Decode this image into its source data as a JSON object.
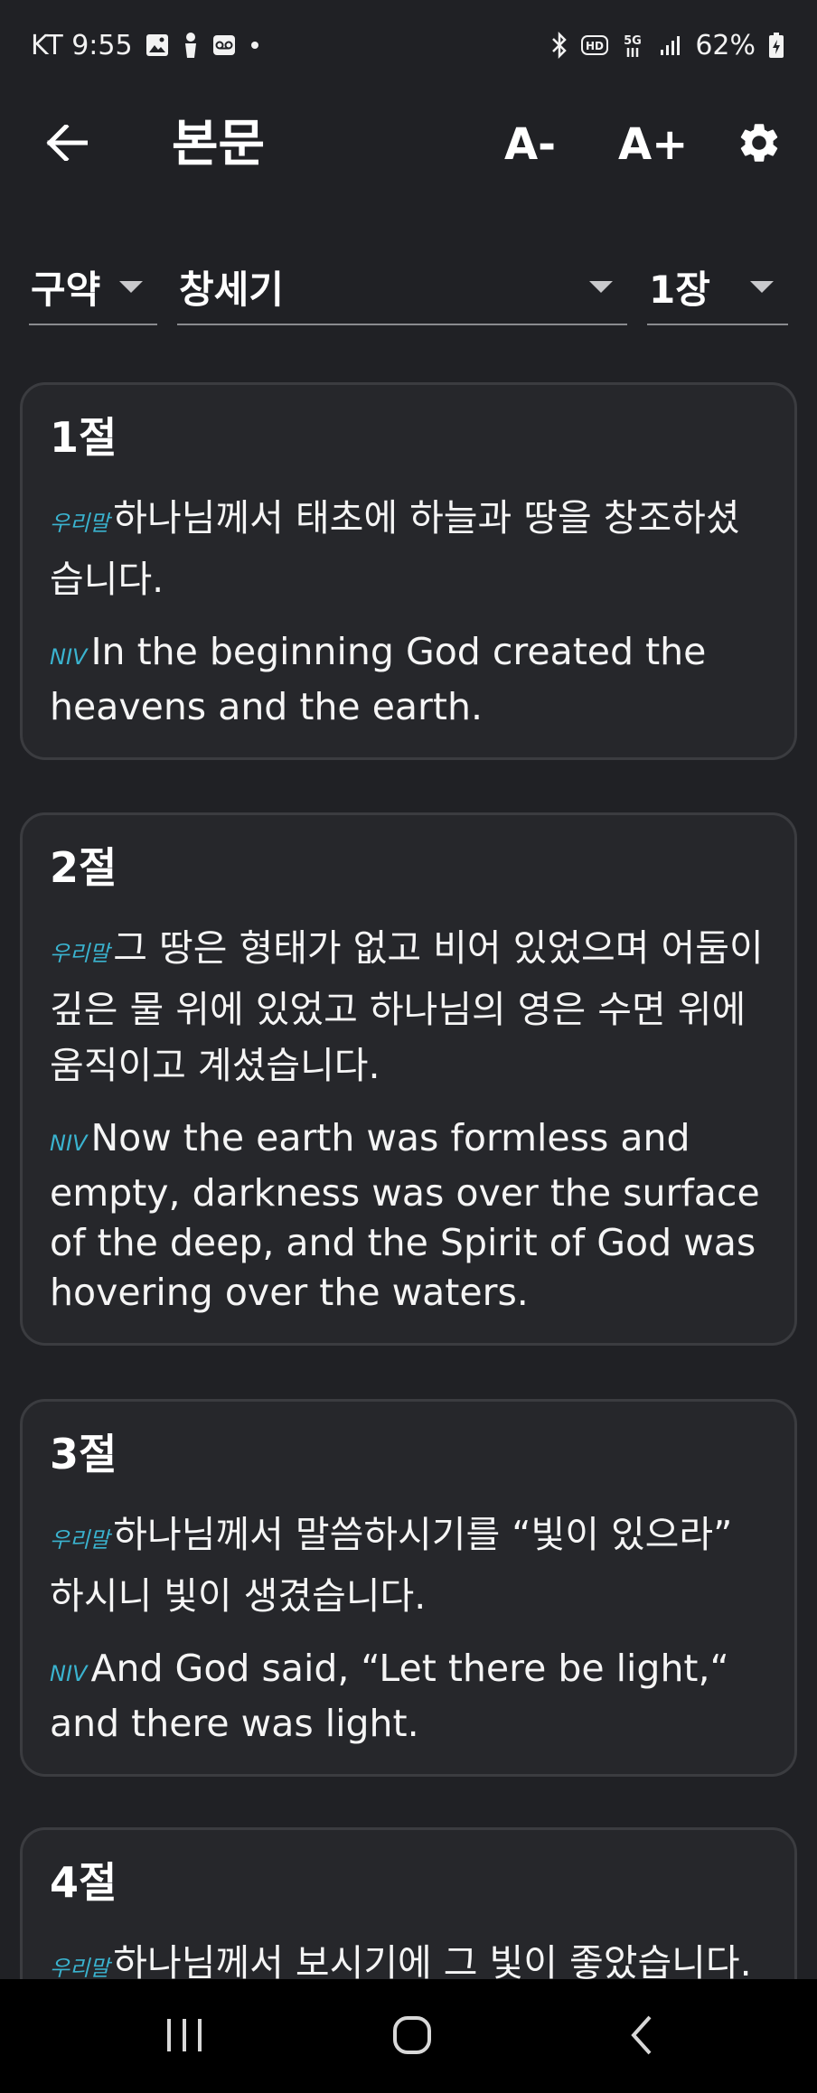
{
  "status_bar": {
    "carrier_time": "KT 9:55",
    "battery": "62%"
  },
  "header": {
    "title": "본문",
    "font_decrease_label": "A-",
    "font_increase_label": "A+"
  },
  "selectors": {
    "testament": "구약",
    "book": "창세기",
    "chapter": "1장"
  },
  "verses": [
    {
      "number": "1절",
      "ko_tag": "우리말",
      "ko_text": "하나님께서 태초에 하늘과 땅을 창조하셨습니다.",
      "en_tag": "NIV",
      "en_text": "In the beginning God created the heavens and the earth."
    },
    {
      "number": "2절",
      "ko_tag": "우리말",
      "ko_text": "그 땅은 형태가 없고 비어 있었으며 어둠이 깊은 물 위에 있었고 하나님의 영은 수면 위에 움직이고 계셨습니다.",
      "en_tag": "NIV",
      "en_text": "Now the earth was formless and empty, darkness was over the surface of the deep, and the Spirit of God was hovering over the waters."
    },
    {
      "number": "3절",
      "ko_tag": "우리말",
      "ko_text": "하나님께서 말씀하시기를 “빛이 있으라” 하시니 빛이 생겼습니다.",
      "en_tag": "NIV",
      "en_text": "And God said, “Let there be light,“ and there was light."
    },
    {
      "number": "4절",
      "ko_tag": "우리말",
      "ko_text": "하나님께서 보시기에 그 빛이 좋았습니다."
    }
  ],
  "icons": {
    "back": "arrow-left-icon",
    "settings": "gear-icon",
    "nav_recents": "recents-icon",
    "nav_home": "home-icon",
    "nav_back": "nav-back-icon"
  },
  "colors": {
    "background": "#202125",
    "card": "#26272b",
    "card_border": "#3b3c40",
    "tag_accent": "#3ab3cf"
  }
}
